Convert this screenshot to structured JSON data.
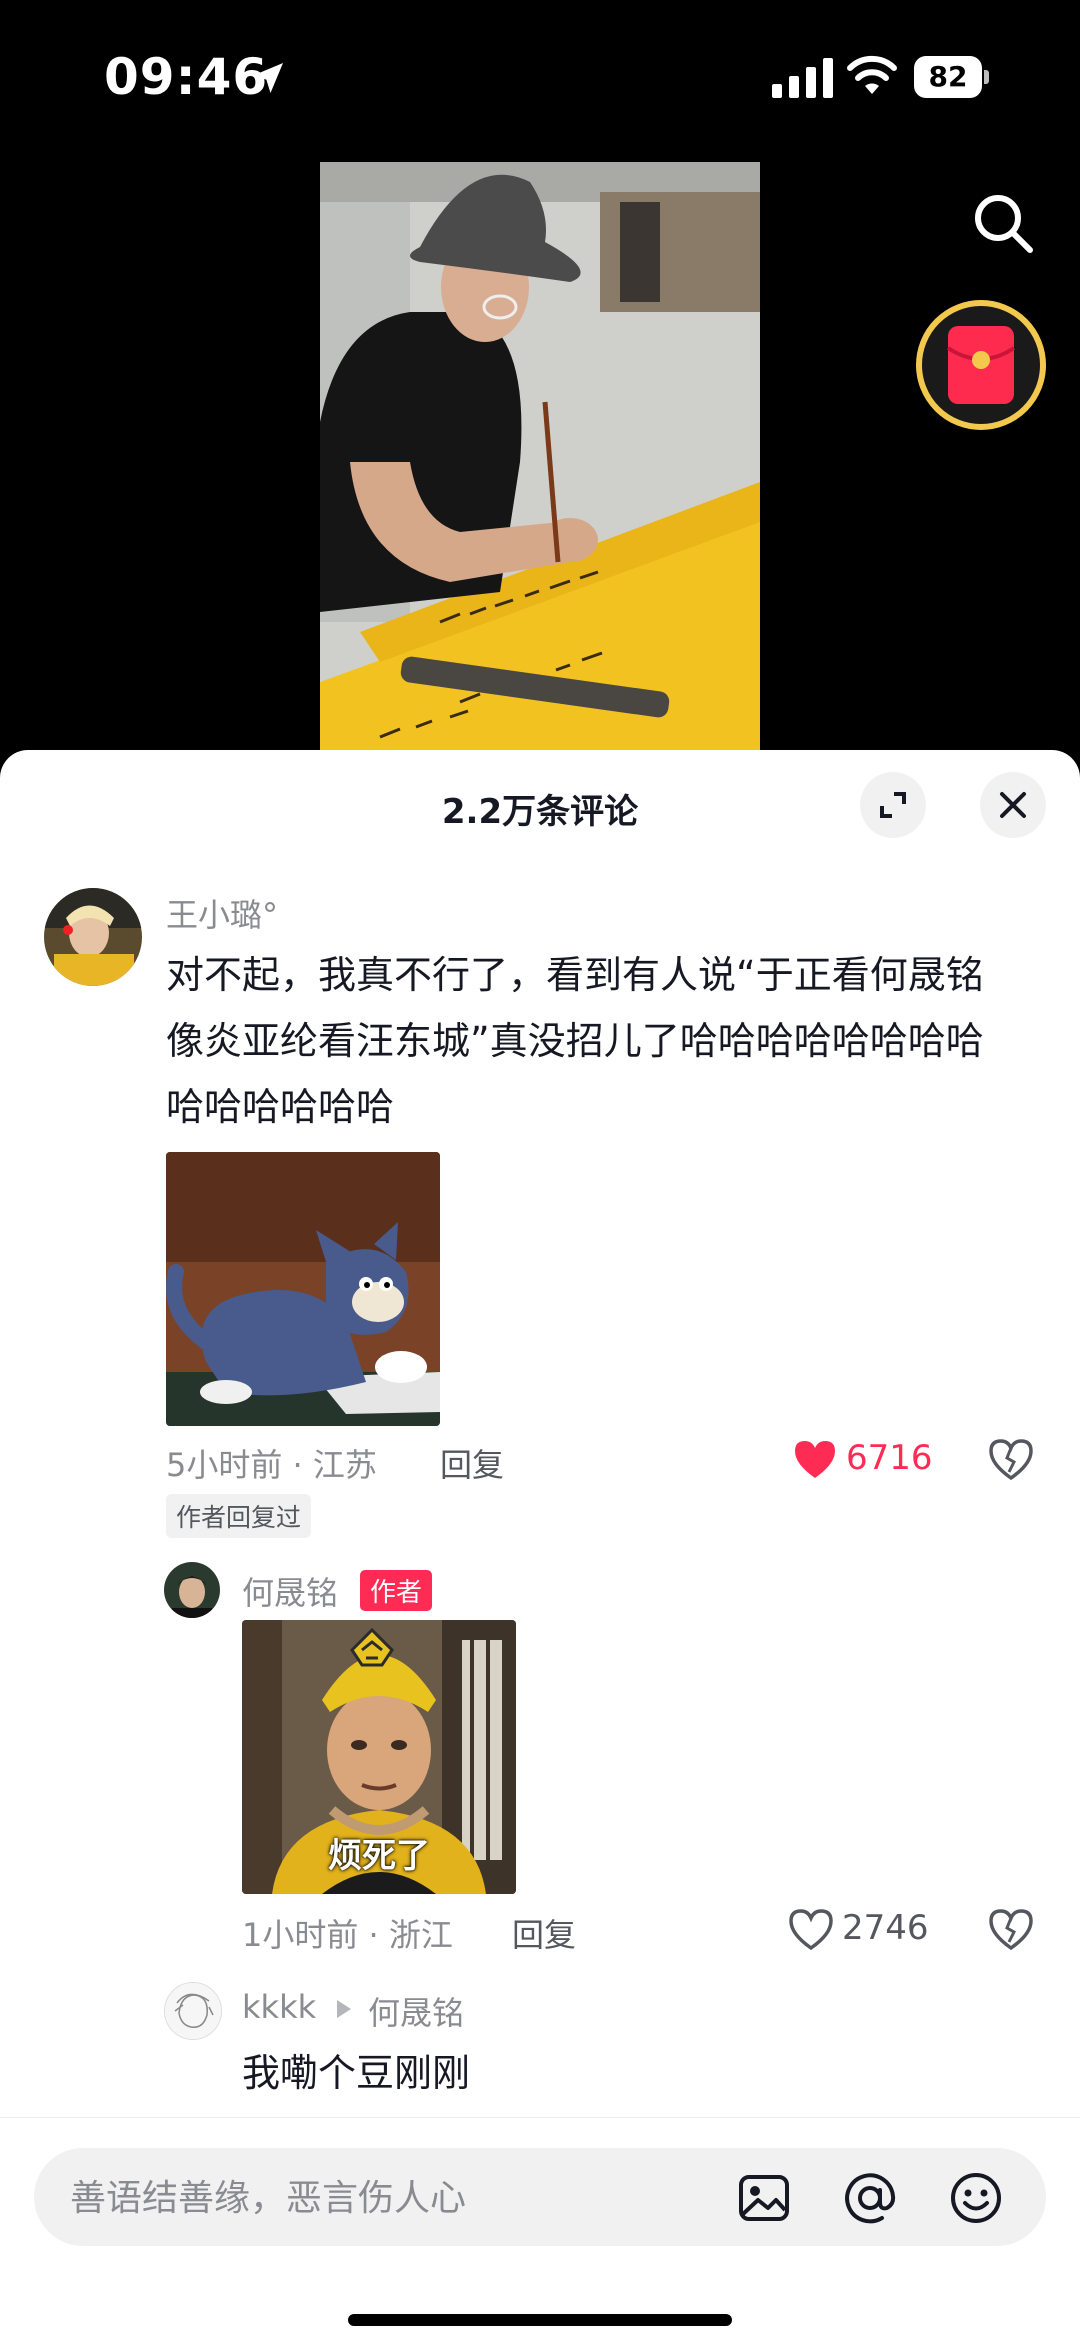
{
  "status_bar": {
    "time": "09:46",
    "battery": "82"
  },
  "sheet": {
    "title": "2.2万条评论"
  },
  "comments": {
    "main": {
      "username": "王小璐°",
      "lines": [
        "对不起，我真不行了，看到有人说“于正看何晟铭",
        "像炎亚纶看汪东城”真没招儿了哈哈哈哈哈哈哈哈",
        "哈哈哈哈哈哈"
      ],
      "time_location": "5小时前 · 江苏",
      "reply_label": "回复",
      "likes": "6716",
      "author_replied_tag": "作者回复过"
    },
    "reply1": {
      "username": "何晟铭",
      "author_badge": "作者",
      "sticker_caption": "烦死了",
      "time_location": "1小时前 · 浙江",
      "reply_label": "回复",
      "likes": "2746"
    },
    "reply2": {
      "username": "kkkk",
      "reply_to": "何晟铭",
      "text": "我嘞个豆刚刚"
    }
  },
  "input": {
    "placeholder": "善语结善缘，恶言伤人心"
  },
  "colors": {
    "accent": "#fe2c55",
    "gold": "#f2c94c",
    "muted": "#8a8b91",
    "text": "#161823"
  }
}
